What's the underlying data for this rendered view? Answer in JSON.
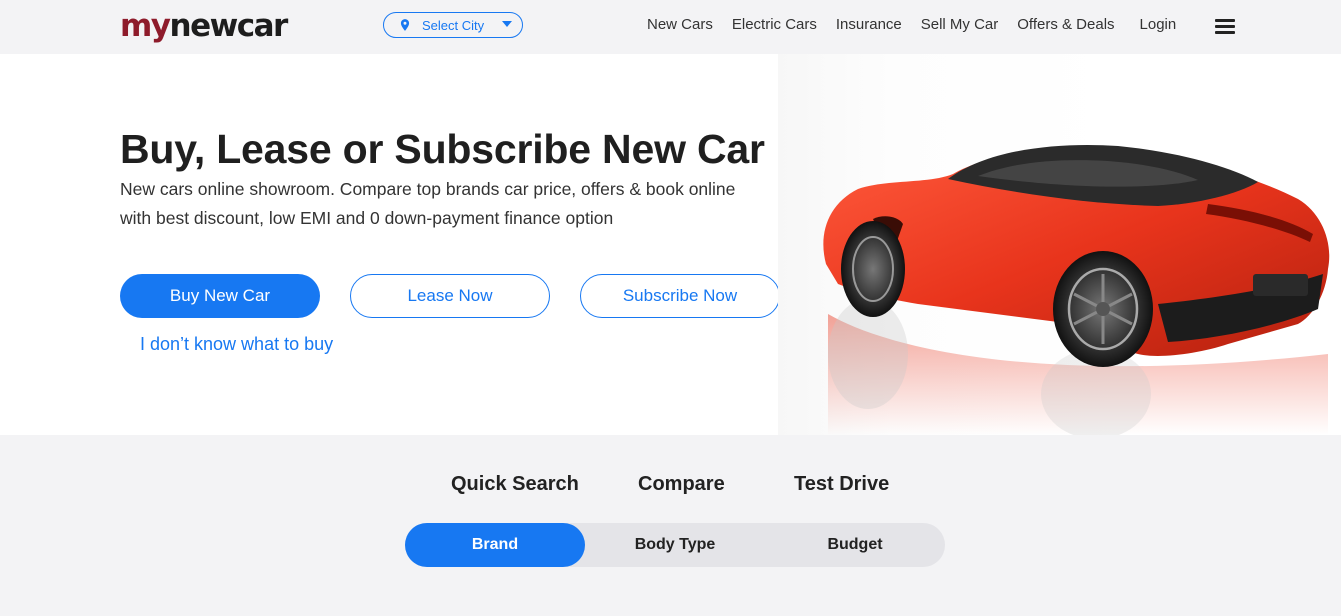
{
  "header": {
    "logo_my": "my",
    "logo_rest": "newcar",
    "city_label": "Select City",
    "nav": [
      "New Cars",
      "Electric Cars",
      "Insurance",
      "Sell My Car",
      "Offers & Deals"
    ],
    "login": "Login"
  },
  "hero": {
    "title": "Buy, Lease or Subscribe New Car",
    "subtitle": "New cars online showroom. Compare top brands car price, offers & book online with best discount, low EMI and 0 down-payment finance option",
    "buy_label": "Buy New Car",
    "lease_label": "Lease Now",
    "subscribe_label": "Subscribe Now",
    "dont_know_label": "I don’t know what to buy"
  },
  "search": {
    "tabs": [
      "Quick Search",
      "Compare",
      "Test Drive"
    ],
    "filters": [
      "Brand",
      "Body Type",
      "Budget"
    ],
    "active_filter": "Brand"
  },
  "colors": {
    "accent": "#1778f2",
    "logo_red": "#8e1b2b",
    "car_red": "#e8341c"
  }
}
